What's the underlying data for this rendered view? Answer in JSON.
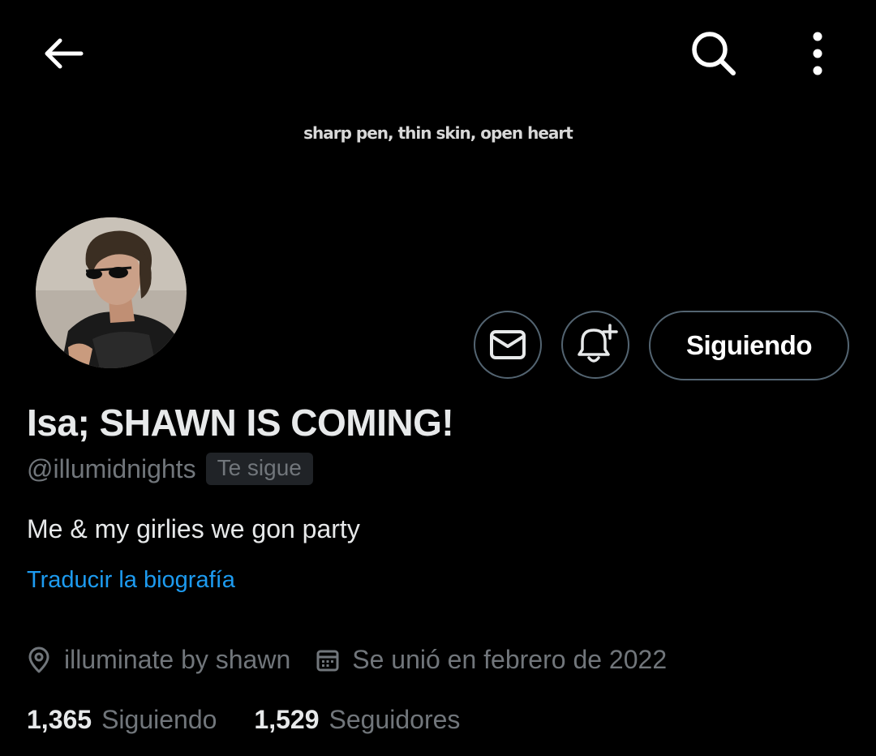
{
  "topbar": {
    "back_icon": "arrow-left-icon",
    "search_icon": "search-icon",
    "more_icon": "more-vertical-icon"
  },
  "banner": {
    "text": "sharp pen, thin skin, open heart"
  },
  "profile": {
    "display_name": "Isa; SHAWN IS COMING!",
    "handle": "@illumidnights",
    "follows_you_badge": "Te sigue",
    "bio": "Me & my girlies we gon party",
    "translate_link": "Traducir la biografía",
    "location": "illuminate by shawn",
    "joined": "Se unió en febrero de 2022"
  },
  "actions": {
    "message_icon": "mail-icon",
    "notify_icon": "bell-plus-icon",
    "follow_label": "Siguiendo"
  },
  "stats": {
    "following_count": "1,365",
    "following_label": "Siguiendo",
    "followers_count": "1,529",
    "followers_label": "Seguidores"
  },
  "colors": {
    "background": "#000000",
    "primary_text": "#e7e9ea",
    "secondary_text": "#71767b",
    "link": "#1d9bf0",
    "button_border": "#536471"
  }
}
